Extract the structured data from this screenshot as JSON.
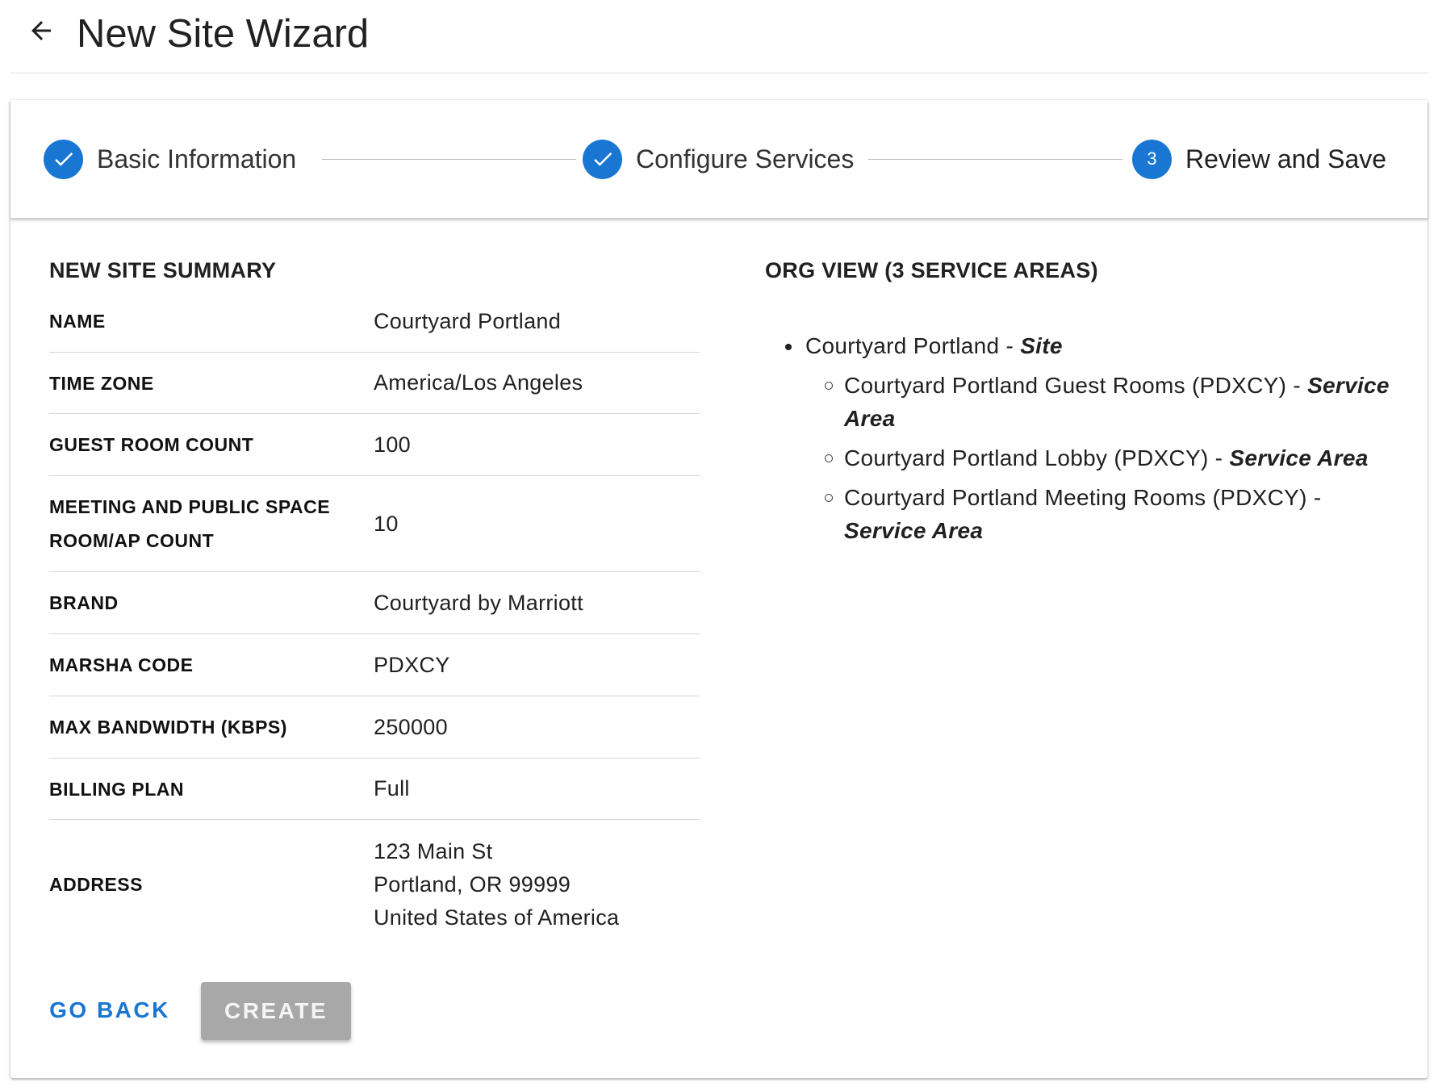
{
  "header": {
    "title": "New Site Wizard"
  },
  "stepper": {
    "steps": [
      {
        "label": "Basic Information",
        "state": "complete"
      },
      {
        "label": "Configure Services",
        "state": "complete"
      },
      {
        "label": "Review and Save",
        "state": "active",
        "number": "3"
      }
    ]
  },
  "summary": {
    "title": "NEW SITE SUMMARY",
    "rows": [
      {
        "label": "NAME",
        "value": "Courtyard Portland"
      },
      {
        "label": "TIME ZONE",
        "value": "America/Los Angeles"
      },
      {
        "label": "GUEST ROOM COUNT",
        "value": "100"
      },
      {
        "label": "MEETING AND PUBLIC SPACE ROOM/AP COUNT",
        "value": "10"
      },
      {
        "label": "BRAND",
        "value": "Courtyard by Marriott"
      },
      {
        "label": "MARSHA CODE",
        "value": "PDXCY"
      },
      {
        "label": "MAX BANDWIDTH (KBPS)",
        "value": "250000"
      },
      {
        "label": "BILLING PLAN",
        "value": "Full"
      },
      {
        "label": "ADDRESS",
        "value_lines": [
          "123 Main St",
          "Portland, OR 99999",
          "United States of America"
        ]
      }
    ]
  },
  "org_view": {
    "title": "ORG VIEW (3 SERVICE AREAS)",
    "site": {
      "name": "Courtyard Portland",
      "separator": " - ",
      "type": "Site"
    },
    "service_areas": [
      {
        "name": "Courtyard Portland Guest Rooms (PDXCY)",
        "separator": " - ",
        "type": "Service Area"
      },
      {
        "name": "Courtyard Portland Lobby (PDXCY)",
        "separator": " - ",
        "type": "Service Area"
      },
      {
        "name": "Courtyard Portland Meeting Rooms (PDXCY)",
        "separator": " - ",
        "type": "Service Area"
      }
    ]
  },
  "actions": {
    "go_back_label": "GO BACK",
    "create_label": "CREATE"
  },
  "colors": {
    "primary": "#1976d2",
    "disabled_button": "#a8a8a8"
  },
  "icons": {
    "back": "arrow-left-icon",
    "complete": "check-icon"
  }
}
